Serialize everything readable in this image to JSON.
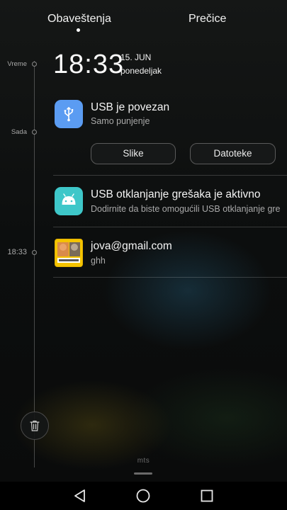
{
  "header": {
    "tabs": [
      {
        "label": "Obaveštenja",
        "active": true
      },
      {
        "label": "Prečice",
        "active": false
      }
    ]
  },
  "timeline": {
    "labels": [
      "Vreme",
      "Sada",
      "18:33"
    ]
  },
  "clock": {
    "time": "18:33",
    "date": "15. JUN",
    "weekday": "ponedeljak"
  },
  "notifications": [
    {
      "icon": "usb-icon",
      "icon_color": "#5b9cf2",
      "title": "USB je povezan",
      "subtitle": "Samo punjenje",
      "actions": [
        "Slike",
        "Datoteke"
      ]
    },
    {
      "icon": "android-icon",
      "icon_color": "#3ec7c9",
      "title": "USB otklanjanje grešaka je aktivno",
      "subtitle": "Dodirnite da biste omogućili USB otklanjanje grešaka."
    },
    {
      "icon": "email-app-icon",
      "icon_color": "#f5c400",
      "title": "jova@gmail.com",
      "subtitle": "ghh"
    }
  ],
  "footer": {
    "carrier": "mts"
  },
  "navbar": {
    "buttons": [
      "back-icon",
      "home-icon",
      "recents-icon"
    ]
  }
}
